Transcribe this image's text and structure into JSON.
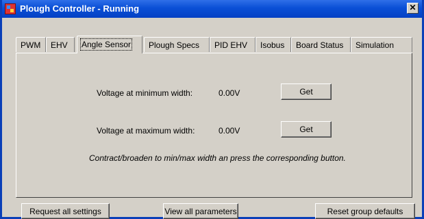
{
  "window": {
    "title": "Plough Controller - Running",
    "close_glyph": "✕",
    "icon": "app-icon"
  },
  "tabs": [
    {
      "label": "PWM",
      "active": false
    },
    {
      "label": "EHV",
      "active": false
    },
    {
      "label": "Angle Sensor",
      "active": true
    },
    {
      "label": "Plough Specs",
      "active": false
    },
    {
      "label": "PID EHV",
      "active": false
    },
    {
      "label": "Isobus",
      "active": false
    },
    {
      "label": "Board Status",
      "active": false
    },
    {
      "label": "Simulation",
      "active": false
    }
  ],
  "angle_sensor": {
    "min_label": "Voltage at minimum width:",
    "min_value": "0.00V",
    "min_button": "Get",
    "max_label": "Voltage at maximum width:",
    "max_value": "0.00V",
    "max_button": "Get",
    "hint": "Contract/broaden to min/max width an press the corresponding button."
  },
  "footer": {
    "request_all": "Request all settings",
    "view_all": "View all parameters",
    "reset_group": "Reset group defaults"
  }
}
